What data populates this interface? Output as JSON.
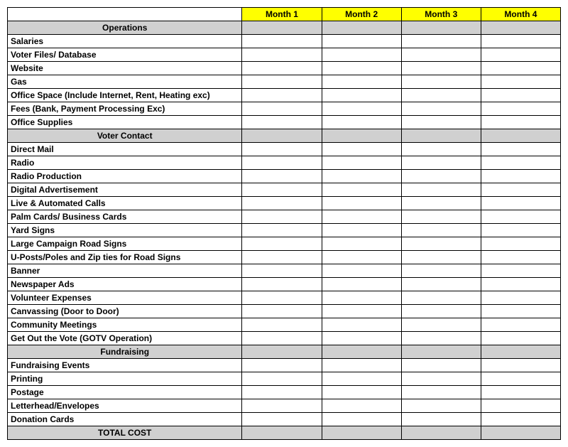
{
  "columns": [
    "Month 1",
    "Month 2",
    "Month 3",
    "Month 4"
  ],
  "sections": [
    {
      "title": "Operations",
      "items": [
        "Salaries",
        "Voter Files/ Database",
        "Website",
        "Gas",
        "Office Space (Include Internet, Rent, Heating exc)",
        "Fees (Bank, Payment Processing Exc)",
        "Office Supplies"
      ]
    },
    {
      "title": "Voter Contact",
      "items": [
        "Direct Mail",
        "Radio",
        "Radio Production",
        "Digital Advertisement",
        "Live & Automated Calls",
        "Palm Cards/ Business Cards",
        "Yard Signs",
        "Large Campaign Road Signs",
        "U-Posts/Poles and Zip ties for Road Signs",
        "Banner",
        "Newspaper Ads",
        "Volunteer Expenses",
        "Canvassing (Door to Door)",
        "Community Meetings",
        "Get Out the Vote (GOTV Operation)"
      ]
    },
    {
      "title": "Fundraising",
      "items": [
        "Fundraising Events",
        "Printing",
        "Postage",
        "Letterhead/Envelopes",
        "Donation Cards"
      ]
    }
  ],
  "totalLabel": "TOTAL COST"
}
